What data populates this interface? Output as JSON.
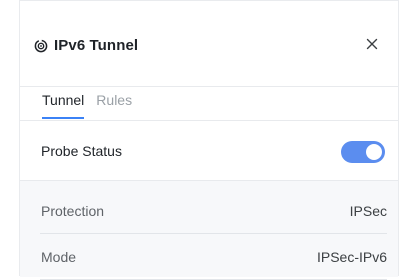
{
  "header": {
    "title": "IPv6 Tunnel",
    "title_icon": "broadcast-icon",
    "close_icon": "close-icon"
  },
  "tabs": [
    {
      "label": "Tunnel",
      "active": true
    },
    {
      "label": "Rules",
      "active": false
    }
  ],
  "probe": {
    "label": "Probe Status",
    "enabled": true
  },
  "details": [
    {
      "key": "Protection",
      "value": "IPSec"
    },
    {
      "key": "Mode",
      "value": "IPSec-IPv6"
    }
  ],
  "colors": {
    "accent": "#3b82f6",
    "toggle_on": "#5b8def",
    "info_bg": "#f7f8fa"
  }
}
